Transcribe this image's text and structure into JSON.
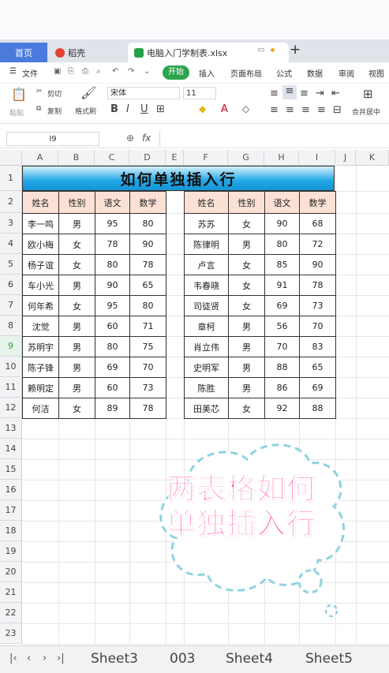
{
  "tabs": {
    "home": "首页",
    "daoke": "稻壳",
    "file": "电脑入门学制表.xlsx",
    "add": "+"
  },
  "ribbon": {
    "menu": "文件",
    "kaishi": "开始",
    "tabs": [
      "插入",
      "页面布局",
      "公式",
      "数据",
      "审阅",
      "视图"
    ],
    "cut": "剪切",
    "paste": "粘贴",
    "copy": "复制",
    "format_painter": "格式刷",
    "font": "宋体",
    "size": "11",
    "merge": "合并居中"
  },
  "formula_bar": {
    "name_box": "I9",
    "fx": "fx"
  },
  "columns": [
    "A",
    "B",
    "C",
    "D",
    "E",
    "F",
    "G",
    "H",
    "I",
    "J",
    "K"
  ],
  "rows": [
    "1",
    "2",
    "3",
    "4",
    "5",
    "6",
    "7",
    "8",
    "9",
    "10",
    "11",
    "12",
    "13",
    "14",
    "15",
    "16",
    "17",
    "18",
    "19",
    "20",
    "21",
    "22",
    "23"
  ],
  "title": "如何单独插入行",
  "headers": [
    "姓名",
    "性别",
    "语文",
    "数学"
  ],
  "left_table": [
    [
      "李一鸣",
      "男",
      "95",
      "80"
    ],
    [
      "欧小梅",
      "女",
      "78",
      "90"
    ],
    [
      "杨子谊",
      "女",
      "80",
      "78"
    ],
    [
      "车小光",
      "男",
      "90",
      "65"
    ],
    [
      "何年希",
      "女",
      "95",
      "80"
    ],
    [
      "沈觉",
      "男",
      "60",
      "71"
    ],
    [
      "苏明宇",
      "男",
      "80",
      "75"
    ],
    [
      "陈子锋",
      "男",
      "69",
      "70"
    ],
    [
      "赖明定",
      "男",
      "60",
      "73"
    ],
    [
      "何洁",
      "女",
      "89",
      "78"
    ]
  ],
  "right_table": [
    [
      "苏苏",
      "女",
      "90",
      "68"
    ],
    [
      "陈律明",
      "男",
      "80",
      "72"
    ],
    [
      "卢言",
      "女",
      "85",
      "90"
    ],
    [
      "韦春晓",
      "女",
      "91",
      "78"
    ],
    [
      "司徒贤",
      "女",
      "69",
      "73"
    ],
    [
      "章柯",
      "男",
      "56",
      "70"
    ],
    [
      "肖立伟",
      "男",
      "70",
      "83"
    ],
    [
      "史明军",
      "男",
      "88",
      "65"
    ],
    [
      "陈胜",
      "男",
      "86",
      "69"
    ],
    [
      "田美芯",
      "女",
      "92",
      "88"
    ]
  ],
  "cloud_text": [
    "两表格如何",
    "单独插入行"
  ],
  "sheets": [
    "Sheet3",
    "003",
    "Sheet4",
    "Sheet5"
  ],
  "colors": {
    "accent": "#2ca44c",
    "title_blue": "#1fa3e4",
    "header_peach": "#fbe1d5",
    "cloud_pink": "#ff4fa5"
  }
}
